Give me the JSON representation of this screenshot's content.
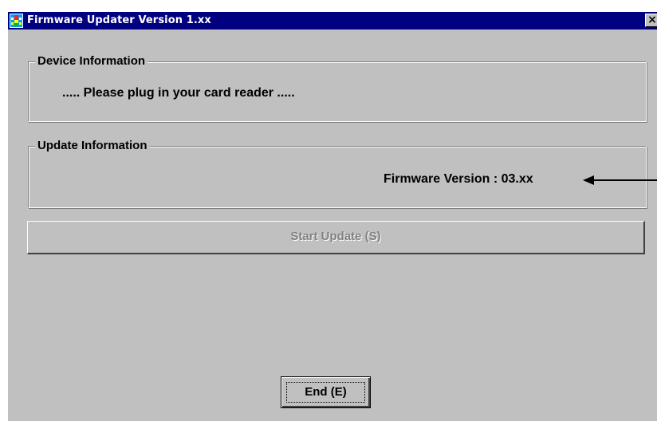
{
  "window": {
    "title": "Firmware Updater Version 1.xx",
    "close_symbol": "×",
    "app_icon": "firmware-updater-icon"
  },
  "device_info": {
    "group_label": "Device Information",
    "message": "..... Please plug in your card reader ....."
  },
  "update_info": {
    "group_label": "Update Information",
    "firmware_version": "Firmware Version : 03.xx"
  },
  "buttons": {
    "start_update": {
      "label": "Start Update (S)",
      "enabled": false
    },
    "end": {
      "label": "End (E)"
    }
  },
  "colors": {
    "titlebar": "#000080",
    "face": "#c0c0c0",
    "disabled_text": "#808080"
  }
}
